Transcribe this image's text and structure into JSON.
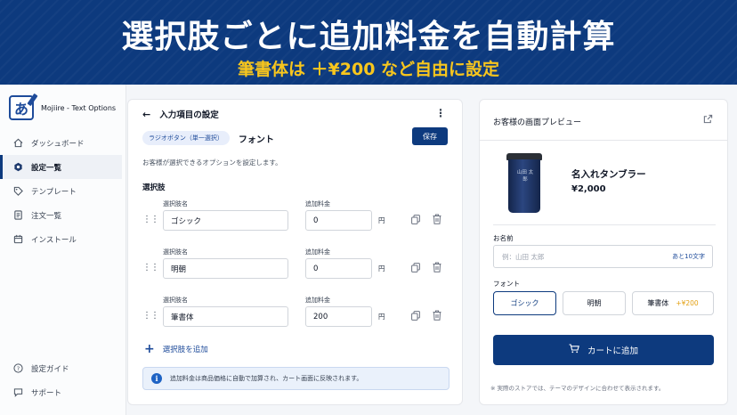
{
  "banner": {
    "title": "選択肢ごとに追加料金を自動計算",
    "subtitle": "筆書体は ＋¥200 など自由に設定"
  },
  "app": {
    "name": "Mojiire - Text Options",
    "logo_glyph": "あ"
  },
  "sidebar": {
    "items": [
      {
        "label": "ダッシュボード",
        "icon": "home-icon"
      },
      {
        "label": "設定一覧",
        "icon": "gear-icon",
        "active": true
      },
      {
        "label": "テンプレート",
        "icon": "tag-icon"
      },
      {
        "label": "注文一覧",
        "icon": "document-icon"
      },
      {
        "label": "インストール",
        "icon": "calendar-icon"
      }
    ],
    "bottom": [
      {
        "label": "設定ガイド",
        "icon": "help-icon"
      },
      {
        "label": "サポート",
        "icon": "chat-icon"
      }
    ]
  },
  "editor": {
    "header": "入力項目の設定",
    "type_badge": "ラジオボタン（単一選択）",
    "field_title": "フォント",
    "save_label": "保存",
    "description": "お客様が選択できるオプションを設定します。",
    "section_label": "選択肢",
    "option_name_label": "選択肢名",
    "price_label": "追加料金",
    "currency_unit": "円",
    "options": [
      {
        "name": "ゴシック",
        "price": "0"
      },
      {
        "name": "明朝",
        "price": "0"
      },
      {
        "name": "筆書体",
        "price": "200"
      }
    ],
    "add_label": "選択肢を追加",
    "info_text": "追加料金は商品価格に自動で加算され、カート画面に反映されます。"
  },
  "preview": {
    "title": "お客様の画面プレビュー",
    "product_name": "名入れタンブラー",
    "price": "¥2,000",
    "engraving": "山田 太郎",
    "name_label": "お名前",
    "name_placeholder": "例：山田 太郎",
    "char_count": "あと10文字",
    "font_label": "フォント",
    "font_options": [
      {
        "label": "ゴシック",
        "selected": true
      },
      {
        "label": "明朝"
      },
      {
        "label": "筆書体",
        "surcharge": "+¥200"
      }
    ],
    "cart_label": "カートに追加",
    "footnote": "※ 実際のストアでは、テーマのデザインに合わせて表示されます。"
  },
  "colors": {
    "primary": "#0d3a7e",
    "accent": "#f8c61d",
    "surcharge": "#e3a012"
  }
}
